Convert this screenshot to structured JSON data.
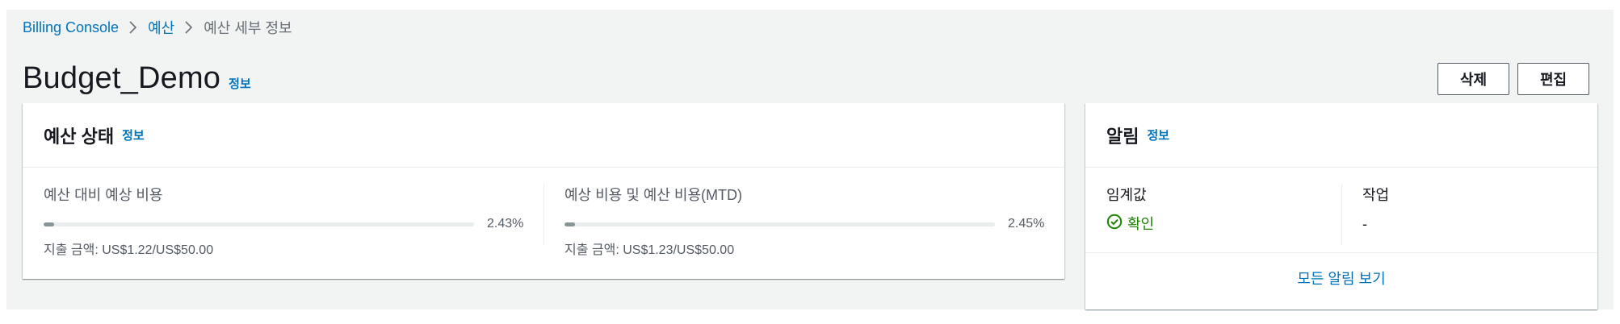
{
  "breadcrumb": {
    "items": [
      "Billing Console",
      "예산",
      "예산 세부 정보"
    ]
  },
  "header": {
    "title": "Budget_Demo",
    "info_label": "정보",
    "delete_label": "삭제",
    "edit_label": "편집"
  },
  "budget_status": {
    "title": "예산 상태",
    "info_label": "정보",
    "metrics": [
      {
        "label": "예산 대비 예상 비용",
        "percent_text": "2.43%",
        "percent": 2.43,
        "spend_text": "지출 금액: US$1.22/US$50.00"
      },
      {
        "label": "예상 비용 및 예산 비용(MTD)",
        "percent_text": "2.45%",
        "percent": 2.45,
        "spend_text": "지출 금액: US$1.23/US$50.00"
      }
    ]
  },
  "alerts": {
    "title": "알림",
    "info_label": "정보",
    "threshold_label": "임계값",
    "threshold_status": "확인",
    "action_label": "작업",
    "action_value": "-",
    "view_all_label": "모든 알림 보기"
  },
  "colors": {
    "link": "#0073bb",
    "success": "#1d8102",
    "progress_fill": "#879596",
    "progress_track": "#eaeded",
    "page_background": "#f2f3f3"
  },
  "icons": {
    "breadcrumb_separator": "chevron-right-icon",
    "threshold_status": "check-circle-icon"
  }
}
